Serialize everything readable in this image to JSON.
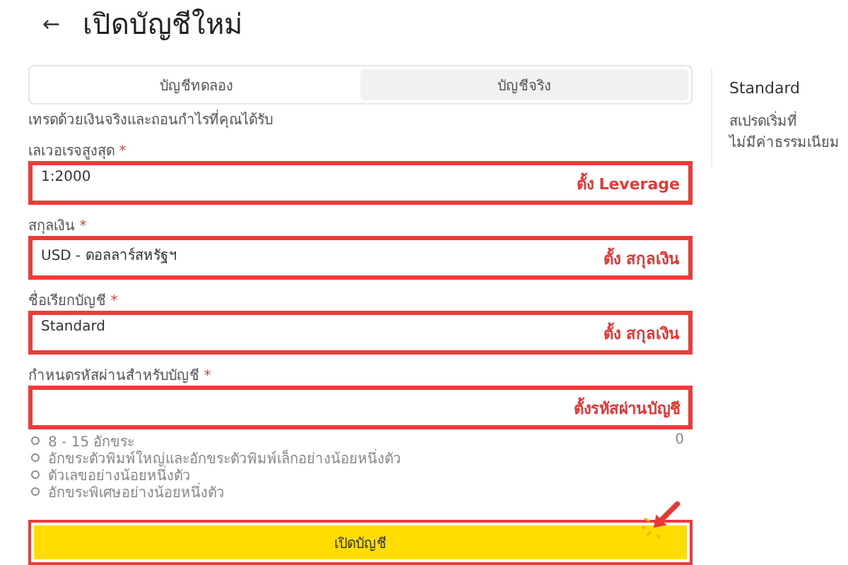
{
  "header": {
    "back": "←",
    "title": "เปิดบัญชีใหม่"
  },
  "tabs": [
    {
      "label": "บัญชีทดลอง",
      "selected": false
    },
    {
      "label": "บัญชีจริง",
      "selected": true
    }
  ],
  "subtitle": "เทรดด้วยเงินจริงและถอนกำไรที่คุณได้รับ",
  "fields": [
    {
      "label": "เลเวอเรจสูงสุด",
      "required": "*",
      "value": "1:2000",
      "highlighted": true,
      "note": "ตั้ง Leverage"
    },
    {
      "label": "สกุลเงิน",
      "required": "*",
      "value": "USD - ดอลลาร์สหรัฐฯ",
      "highlighted": true,
      "note": "ตั้ง สกุลเงิน"
    },
    {
      "label": "ชื่อเรียกบัญชี",
      "required": "*",
      "value": "Standard",
      "highlighted": true,
      "note": "ตั้ง สกุลเงิน"
    },
    {
      "label": "กำหนดรหัสผ่านสำหรับบัญชี",
      "required": "*",
      "highlighted": true,
      "note": "ตั้งรหัสผ่านบัญชี"
    }
  ],
  "password_rules": [
    "8 - 15 อักขระ",
    "อักขระตัวพิมพ์ใหญ่และอักขระตัวพิมพ์เล็กอย่างน้อยหนึ่งตัว",
    "ตัวเลขอย่างน้อยหนึ่งตัว",
    "อักขระพิเศษอย่างน้อยหนึ่งตัว"
  ],
  "char_count": "0",
  "submit": {
    "label": "เปิดบัญชี",
    "highlighted": true
  },
  "sidebar": {
    "title": "Standard",
    "lines": [
      "สเปรดเริ่มที่",
      "ไม่มีค่าธรรมเนียม"
    ]
  }
}
